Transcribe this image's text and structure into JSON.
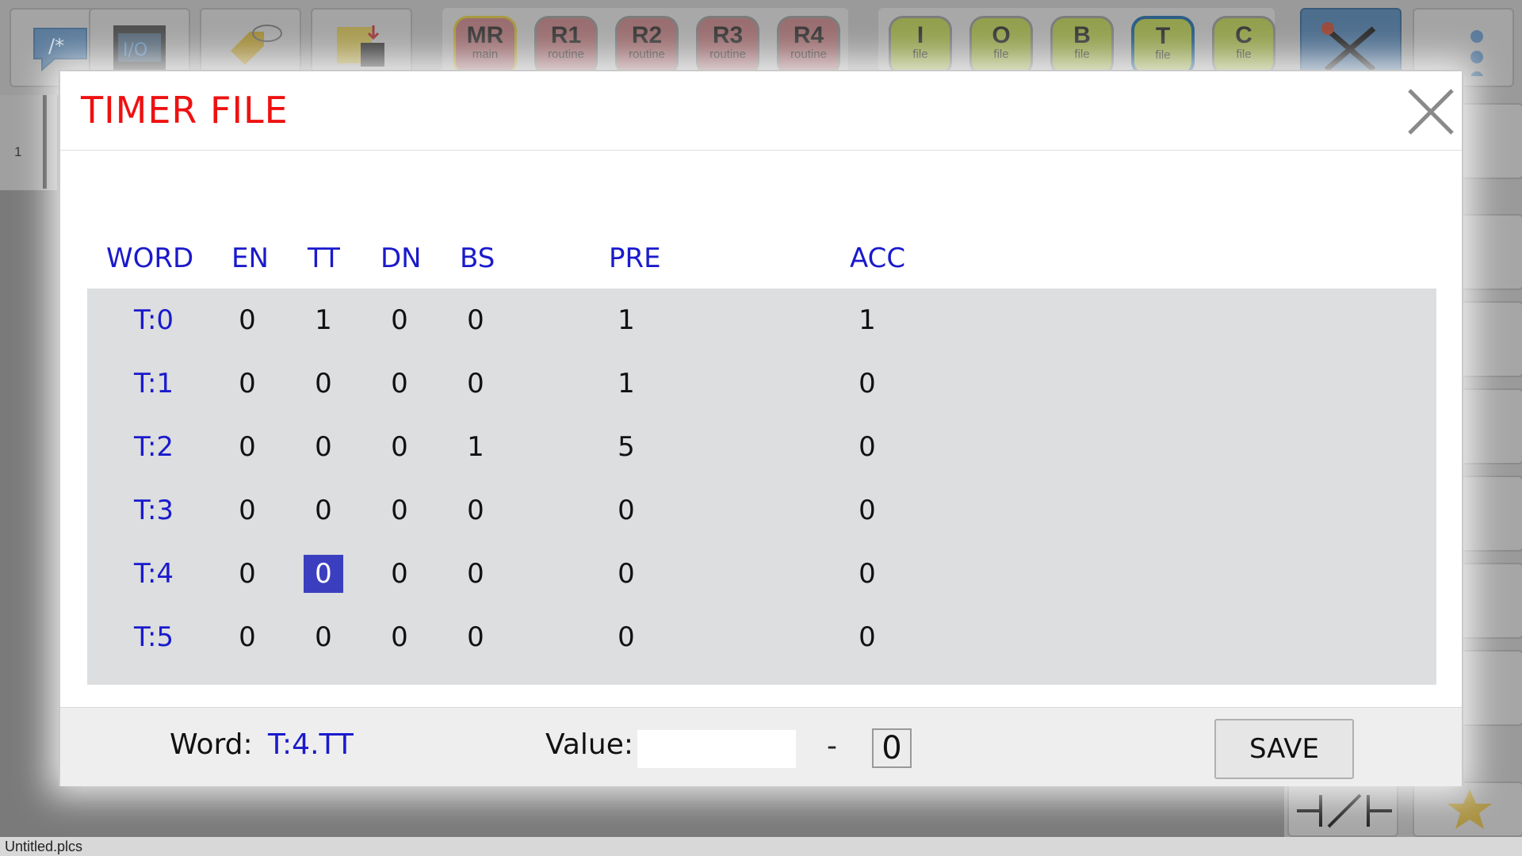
{
  "toolbar": {
    "routines": [
      {
        "big": "MR",
        "small": "main"
      },
      {
        "big": "R1",
        "small": "routine"
      },
      {
        "big": "R2",
        "small": "routine"
      },
      {
        "big": "R3",
        "small": "routine"
      },
      {
        "big": "R4",
        "small": "routine"
      }
    ],
    "files": [
      {
        "big": "I",
        "small": "file"
      },
      {
        "big": "O",
        "small": "file"
      },
      {
        "big": "B",
        "small": "file"
      },
      {
        "big": "T",
        "small": "file"
      },
      {
        "big": "C",
        "small": "file"
      }
    ],
    "active_file": "T"
  },
  "rung": {
    "number": "1"
  },
  "status_bar": {
    "filename": "Untitled.plcs"
  },
  "modal": {
    "title": "TIMER FILE",
    "columns": [
      "WORD",
      "EN",
      "TT",
      "DN",
      "BS",
      "PRE",
      "ACC"
    ],
    "rows": [
      {
        "word": "T:0",
        "en": "0",
        "tt": "1",
        "dn": "0",
        "bs": "0",
        "pre": "1",
        "acc": "1"
      },
      {
        "word": "T:1",
        "en": "0",
        "tt": "0",
        "dn": "0",
        "bs": "0",
        "pre": "1",
        "acc": "0"
      },
      {
        "word": "T:2",
        "en": "0",
        "tt": "0",
        "dn": "0",
        "bs": "1",
        "pre": "5",
        "acc": "0"
      },
      {
        "word": "T:3",
        "en": "0",
        "tt": "0",
        "dn": "0",
        "bs": "0",
        "pre": "0",
        "acc": "0"
      },
      {
        "word": "T:4",
        "en": "0",
        "tt": "0",
        "dn": "0",
        "bs": "0",
        "pre": "0",
        "acc": "0"
      },
      {
        "word": "T:5",
        "en": "0",
        "tt": "0",
        "dn": "0",
        "bs": "0",
        "pre": "0",
        "acc": "0"
      }
    ],
    "selected_cell": "T:4.TT",
    "footer": {
      "word_label": "Word:",
      "word_value": "T:4.TT",
      "value_label": "Value:",
      "value_input": "",
      "dash": "-",
      "bit_value": "0",
      "save_label": "SAVE"
    }
  },
  "colors": {
    "title": "#ee1111",
    "header_text": "#1a1acc",
    "grid_bg": "#dcdedf",
    "selection": "#3b3fbf"
  }
}
